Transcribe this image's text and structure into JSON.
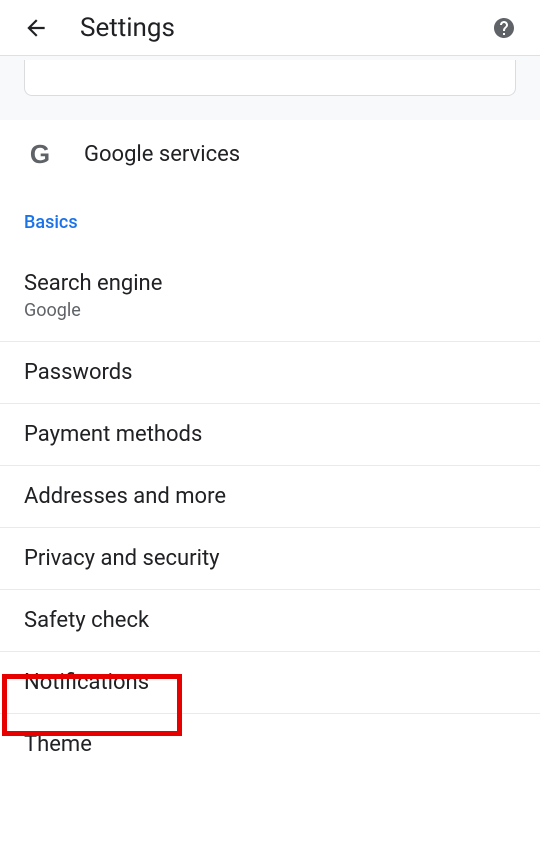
{
  "header": {
    "title": "Settings"
  },
  "google_services": {
    "label": "Google services"
  },
  "section": {
    "basics": "Basics"
  },
  "items": {
    "search_engine": {
      "label": "Search engine",
      "sublabel": "Google"
    },
    "passwords": "Passwords",
    "payment_methods": "Payment methods",
    "addresses": "Addresses and more",
    "privacy": "Privacy and security",
    "safety_check": "Safety check",
    "notifications": "Notifications",
    "theme": "Theme"
  }
}
